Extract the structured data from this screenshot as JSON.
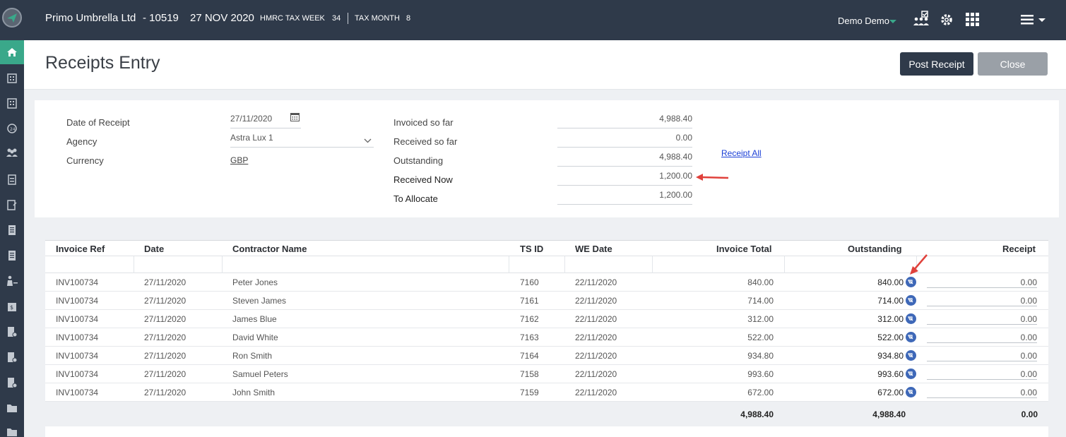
{
  "header": {
    "company": "Primo Umbrella Ltd",
    "code": "- 10519",
    "date": "27 NOV 2020",
    "tax_week_label": "HMRC TAX WEEK",
    "tax_week_value": "34",
    "tax_month_label": "TAX MONTH",
    "tax_month_value": "8",
    "user": "Demo Demo"
  },
  "page": {
    "title": "Receipts Entry",
    "post_button": "Post Receipt",
    "close_button": "Close"
  },
  "form": {
    "date_label": "Date of Receipt",
    "date_value": "27/11/2020",
    "agency_label": "Agency",
    "agency_value": "Astra Lux 1",
    "currency_label": "Currency",
    "currency_value": "GBP",
    "invoiced_label": "Invoiced so far",
    "invoiced_value": "4,988.40",
    "received_label": "Received so far",
    "received_value": "0.00",
    "outstanding_label": "Outstanding",
    "outstanding_value": "4,988.40",
    "received_now_label": "Received Now",
    "received_now_value": "1,200.00",
    "to_allocate_label": "To Allocate",
    "to_allocate_value": "1,200.00",
    "receipt_all": "Receipt All"
  },
  "table": {
    "columns": [
      "Invoice Ref",
      "Date",
      "Contractor Name",
      "TS ID",
      "WE Date",
      "Invoice Total",
      "Outstanding",
      "Receipt"
    ],
    "rows": [
      {
        "ref": "INV100734",
        "date": "27/11/2020",
        "name": "Peter Jones",
        "ts": "7160",
        "we": "22/11/2020",
        "total": "840.00",
        "outstanding": "840.00",
        "receipt": "0.00"
      },
      {
        "ref": "INV100734",
        "date": "27/11/2020",
        "name": "Steven James",
        "ts": "7161",
        "we": "22/11/2020",
        "total": "714.00",
        "outstanding": "714.00",
        "receipt": "0.00"
      },
      {
        "ref": "INV100734",
        "date": "27/11/2020",
        "name": "James Blue",
        "ts": "7162",
        "we": "22/11/2020",
        "total": "312.00",
        "outstanding": "312.00",
        "receipt": "0.00"
      },
      {
        "ref": "INV100734",
        "date": "27/11/2020",
        "name": "David White",
        "ts": "7163",
        "we": "22/11/2020",
        "total": "522.00",
        "outstanding": "522.00",
        "receipt": "0.00"
      },
      {
        "ref": "INV100734",
        "date": "27/11/2020",
        "name": "Ron Smith",
        "ts": "7164",
        "we": "22/11/2020",
        "total": "934.80",
        "outstanding": "934.80",
        "receipt": "0.00"
      },
      {
        "ref": "INV100734",
        "date": "27/11/2020",
        "name": "Samuel Peters",
        "ts": "7158",
        "we": "22/11/2020",
        "total": "993.60",
        "outstanding": "993.60",
        "receipt": "0.00"
      },
      {
        "ref": "INV100734",
        "date": "27/11/2020",
        "name": "John Smith",
        "ts": "7159",
        "we": "22/11/2020",
        "total": "672.00",
        "outstanding": "672.00",
        "receipt": "0.00"
      }
    ],
    "totals": {
      "total": "4,988.40",
      "outstanding": "4,988.40",
      "receipt": "0.00"
    }
  },
  "colors": {
    "topbar": "#2f3a4a",
    "accent": "#3aa88a",
    "info_icon": "#3e68b8",
    "annotation_arrow": "#e0413b"
  }
}
